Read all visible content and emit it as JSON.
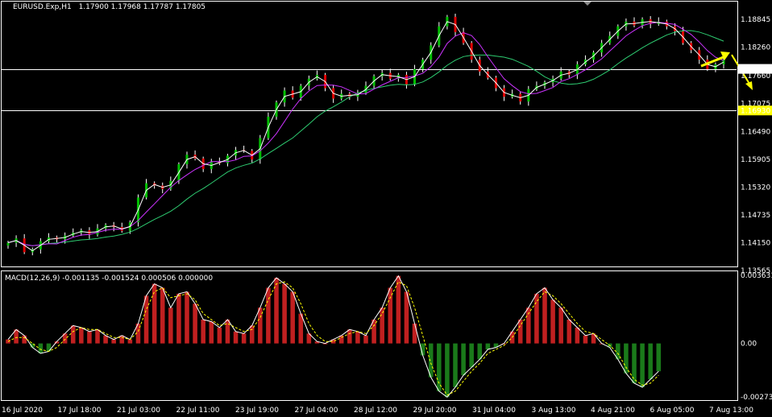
{
  "chart_data": [
    {
      "type": "candlestick",
      "symbol_label": "EURUSD.Exp,H1",
      "ohlc_label": "1.17900 1.17968 1.17787 1.17805",
      "ylim": [
        1.1365,
        1.1922
      ],
      "y_ticks": [
        "1.18845",
        "1.18260",
        "1.17660",
        "1.17075",
        "1.16490",
        "1.15905",
        "1.15320",
        "1.14735",
        "1.14150",
        "1.13565"
      ],
      "price_labels": [
        {
          "value": 1.17805,
          "text": "1.17805",
          "color": "#ffffff",
          "text_color": "#000000"
        },
        {
          "value": 1.1693,
          "text": "1.16930",
          "color": "#ffff00",
          "text_color": "#000000"
        }
      ],
      "x_ticks": [
        "16 Jul 2020",
        "17 Jul 18:00",
        "21 Jul 03:00",
        "22 Jul 11:00",
        "23 Jul 19:00",
        "27 Jul 04:00",
        "28 Jul 12:00",
        "29 Jul 20:00",
        "31 Jul 04:00",
        "3 Aug 13:00",
        "4 Aug 21:00",
        "6 Aug 05:00",
        "7 Aug 13:00"
      ],
      "series": [
        {
          "name": "close",
          "values": [
            1.1415,
            1.1424,
            1.1395,
            1.1401,
            1.1418,
            1.1426,
            1.1422,
            1.143,
            1.1436,
            1.1441,
            1.1432,
            1.1445,
            1.1452,
            1.1448,
            1.144,
            1.1458,
            1.151,
            1.154,
            1.1535,
            1.1528,
            1.1545,
            1.158,
            1.16,
            1.1592,
            1.157,
            1.1585,
            1.1582,
            1.1598,
            1.161,
            1.1608,
            1.159,
            1.1635,
            1.168,
            1.171,
            1.1735,
            1.172,
            1.1745,
            1.176,
            1.1768,
            1.174,
            1.1718,
            1.1728,
            1.1722,
            1.173,
            1.1745,
            1.1765,
            1.1772,
            1.176,
            1.1768,
            1.1748,
            1.178,
            1.18,
            1.183,
            1.187,
            1.189,
            1.1858,
            1.1835,
            1.18,
            1.1775,
            1.1762,
            1.174,
            1.1722,
            1.1728,
            1.1712,
            1.1738,
            1.1745,
            1.1752,
            1.176,
            1.1775,
            1.1768,
            1.179,
            1.18,
            1.1815,
            1.1835,
            1.185,
            1.187,
            1.188,
            1.1872,
            1.1885,
            1.1875,
            1.188,
            1.187,
            1.186,
            1.1835,
            1.182,
            1.18,
            1.178,
            1.179,
            1.18
          ]
        }
      ],
      "annotations": [
        "horizontal line 1.17805 (white)",
        "horizontal line 1.16930 (white)",
        "yellow arrow up",
        "yellow arrow down"
      ],
      "colors": {
        "bull": "#00c000",
        "bear": "#e00000",
        "wick": "#ffffff",
        "ma_fast": "#ffffff",
        "ma_mid": "#cc33ff",
        "ma_slow": "#2ecc71",
        "arrow": "#ffff00"
      }
    },
    {
      "type": "histogram",
      "label": "MACD(12,26,9) -0.001135 -0.001524 0.000506 0.000000",
      "ylim": [
        -0.00285,
        0.00363
      ],
      "y_ticks": [
        {
          "value": 0.003631,
          "text": "0.003631"
        },
        {
          "value": 0.0,
          "text": "0.00"
        },
        {
          "value": -0.002739,
          "text": "-0.002739"
        }
      ],
      "macd_values": [
        0.0002,
        0.0007,
        0.0004,
        -0.0002,
        -0.0005,
        -0.0004,
        0.0001,
        0.0005,
        0.0009,
        0.0008,
        0.0006,
        0.0007,
        0.0004,
        0.0002,
        0.0004,
        0.0002,
        0.001,
        0.0024,
        0.003,
        0.0028,
        0.0018,
        0.0025,
        0.0026,
        0.002,
        0.0012,
        0.0011,
        0.0008,
        0.0012,
        0.0006,
        0.0005,
        0.0009,
        0.0018,
        0.0028,
        0.0033,
        0.003,
        0.0026,
        0.0015,
        0.0005,
        0.0001,
        0.0,
        0.0002,
        0.0004,
        0.0007,
        0.0006,
        0.0004,
        0.0012,
        0.0018,
        0.0028,
        0.0034,
        0.0026,
        0.001,
        -0.0006,
        -0.0017,
        -0.0024,
        -0.0027,
        -0.0022,
        -0.0016,
        -0.0012,
        -0.0008,
        -0.0003,
        -0.0002,
        0.0,
        0.0006,
        0.0012,
        0.0018,
        0.0025,
        0.0028,
        0.0022,
        0.0018,
        0.0012,
        0.0008,
        0.0004,
        0.0005,
        0.0,
        -0.0002,
        -0.0008,
        -0.0015,
        -0.002,
        -0.0022,
        -0.0018,
        -0.0014
      ],
      "signal_values": [
        0.0001,
        0.0003,
        0.0003,
        0.0,
        -0.0003,
        -0.0004,
        -0.0002,
        0.0002,
        0.0006,
        0.0008,
        0.0007,
        0.0007,
        0.0005,
        0.0003,
        0.0003,
        0.0002,
        0.0006,
        0.0017,
        0.0026,
        0.0028,
        0.0023,
        0.0024,
        0.0025,
        0.0022,
        0.0015,
        0.0012,
        0.0009,
        0.001,
        0.0008,
        0.0006,
        0.0007,
        0.0013,
        0.0022,
        0.003,
        0.0031,
        0.0028,
        0.002,
        0.001,
        0.0004,
        0.0001,
        0.0001,
        0.0003,
        0.0005,
        0.0006,
        0.0005,
        0.0009,
        0.0015,
        0.0023,
        0.0031,
        0.0029,
        0.0018,
        0.0004,
        -0.001,
        -0.002,
        -0.0026,
        -0.0024,
        -0.0019,
        -0.0014,
        -0.001,
        -0.0005,
        -0.0003,
        -0.0001,
        0.0003,
        0.0009,
        0.0015,
        0.0021,
        0.0026,
        0.0024,
        0.002,
        0.0015,
        0.001,
        0.0006,
        0.0005,
        0.0002,
        -0.0001,
        -0.0005,
        -0.0012,
        -0.0018,
        -0.0021,
        -0.002,
        -0.0016
      ],
      "colors": {
        "pos": "#c02020",
        "neg": "#1a7a1a",
        "macd": "#ffffff",
        "signal": "#ffff00"
      }
    }
  ]
}
